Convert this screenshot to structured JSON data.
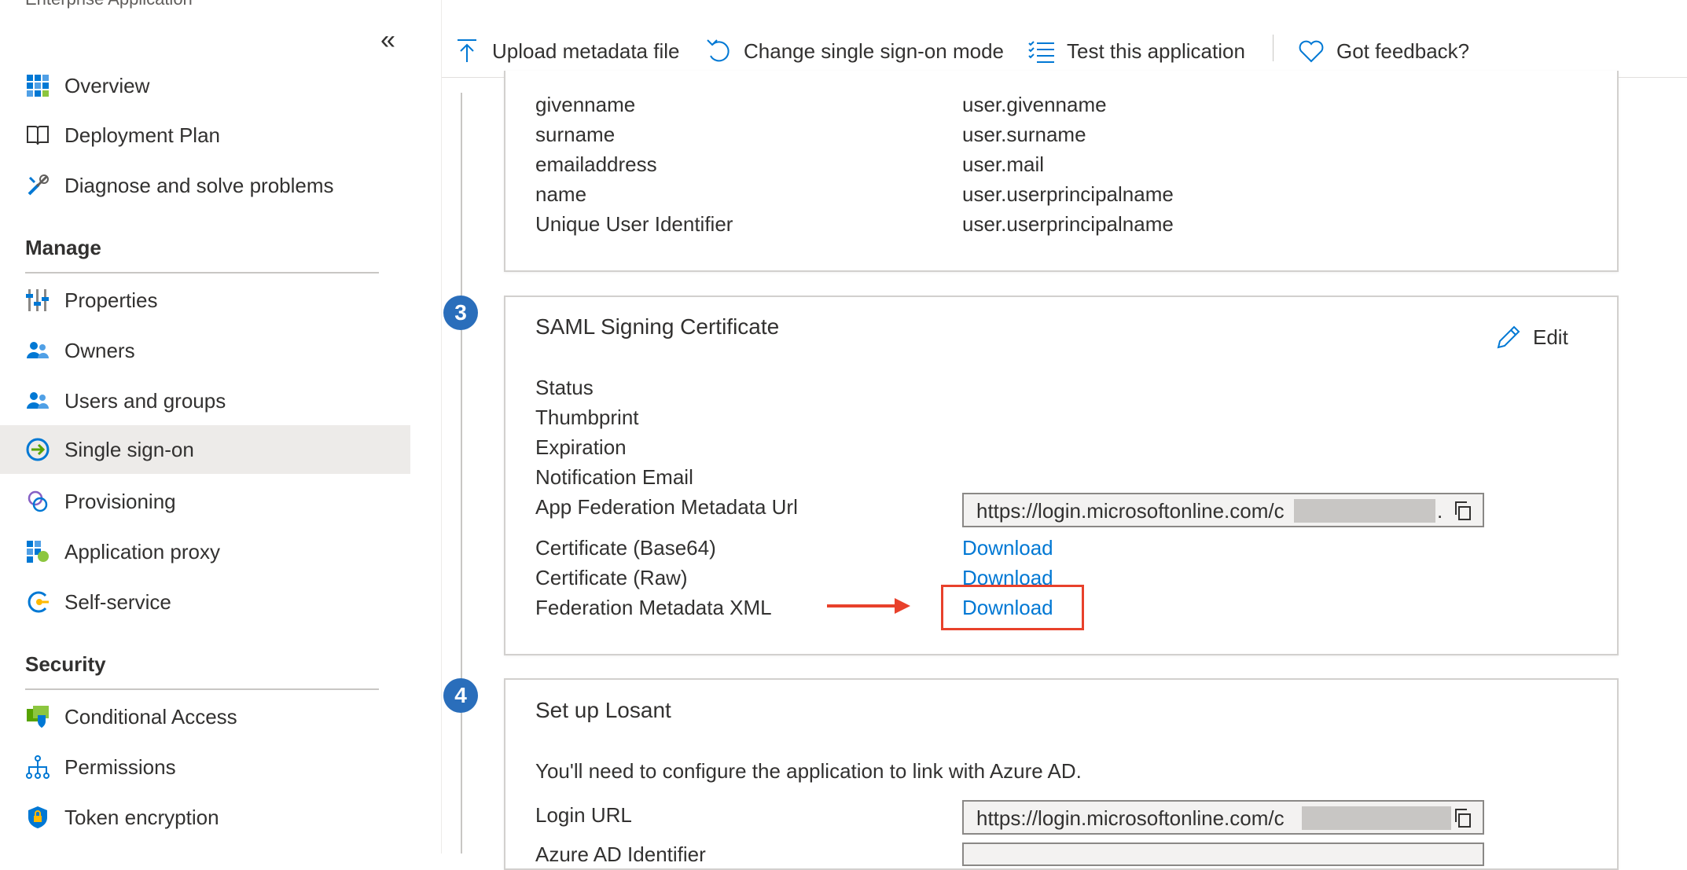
{
  "header": {
    "app_subtitle": "Enterprise Application"
  },
  "sidebar": {
    "collapse_glyph": "«",
    "items": [
      {
        "label": "Overview",
        "icon": "overview-grid-icon"
      },
      {
        "label": "Deployment Plan",
        "icon": "book-icon"
      },
      {
        "label": "Diagnose and solve problems",
        "icon": "wrench-icon"
      }
    ],
    "manage_heading": "Manage",
    "manage_items": [
      {
        "label": "Properties",
        "icon": "properties-sliders-icon"
      },
      {
        "label": "Owners",
        "icon": "owners-people-icon"
      },
      {
        "label": "Users and groups",
        "icon": "users-groups-icon"
      },
      {
        "label": "Single sign-on",
        "icon": "sso-arrow-icon",
        "active": true
      },
      {
        "label": "Provisioning",
        "icon": "provisioning-icon"
      },
      {
        "label": "Application proxy",
        "icon": "app-proxy-icon"
      },
      {
        "label": "Self-service",
        "icon": "self-service-icon"
      }
    ],
    "security_heading": "Security",
    "security_items": [
      {
        "label": "Conditional Access",
        "icon": "conditional-access-icon"
      },
      {
        "label": "Permissions",
        "icon": "permissions-tree-icon"
      },
      {
        "label": "Token encryption",
        "icon": "shield-lock-icon"
      }
    ]
  },
  "toolbar": {
    "upload": "Upload metadata file",
    "change_mode": "Change single sign-on mode",
    "test": "Test this application",
    "feedback": "Got feedback?"
  },
  "claims": {
    "rows": [
      {
        "name": "givenname",
        "value": "user.givenname"
      },
      {
        "name": "surname",
        "value": "user.surname"
      },
      {
        "name": "emailaddress",
        "value": "user.mail"
      },
      {
        "name": "name",
        "value": "user.userprincipalname"
      },
      {
        "name": "Unique User Identifier",
        "value": "user.userprincipalname"
      }
    ]
  },
  "saml_cert": {
    "step": "3",
    "title": "SAML Signing Certificate",
    "edit_label": "Edit",
    "status_label": "Status",
    "thumbprint_label": "Thumbprint",
    "expiration_label": "Expiration",
    "notification_label": "Notification Email",
    "metadata_url_label": "App Federation Metadata Url",
    "metadata_url_value": "https://login.microsoftonline.com/c",
    "metadata_url_trail": ".",
    "cert_base64_label": "Certificate (Base64)",
    "cert_raw_label": "Certificate (Raw)",
    "fed_xml_label": "Federation Metadata XML",
    "download_label": "Download"
  },
  "setup": {
    "step": "4",
    "title": "Set up Losant",
    "description": "You'll need to configure the application to link with Azure AD.",
    "login_url_label": "Login URL",
    "login_url_value": "https://login.microsoftonline.com/c",
    "identifier_label": "Azure AD Identifier"
  },
  "colors": {
    "accent": "#0078d4",
    "step_badge": "#2a6ebb",
    "highlight": "#e8412b",
    "active_bg": "#edebe9"
  }
}
